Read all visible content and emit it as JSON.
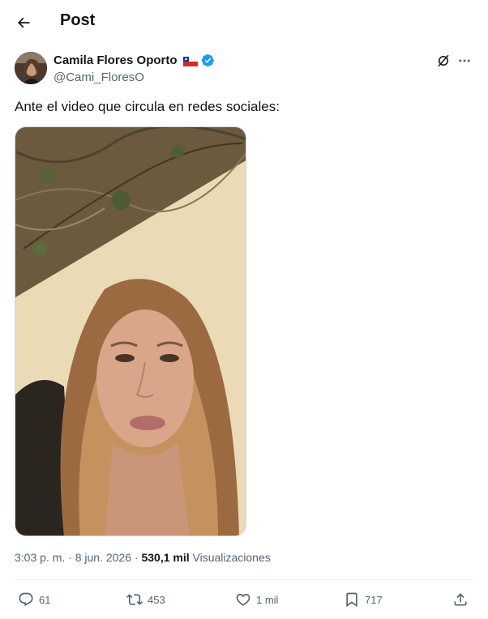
{
  "header": {
    "title": "Post",
    "back_icon": "arrow-left-icon"
  },
  "author": {
    "display_name": "Camila Flores Oporto",
    "flag": "chile-flag-icon",
    "verified": true,
    "handle": "@Cami_FloresO"
  },
  "post": {
    "text": "Ante el video que circula en redes sociales:",
    "media_type": "video"
  },
  "meta": {
    "time": "3:03 p. m.",
    "separator": "·",
    "date": "8 jun. 2026",
    "views_count": "530,1 mil",
    "views_label": "Visualizaciones"
  },
  "actions": {
    "replies": "61",
    "reposts": "453",
    "likes": "1 mil",
    "bookmarks": "717"
  },
  "colors": {
    "verified": "#1d9bf0",
    "secondary_text": "#536471",
    "primary_text": "#0f1419"
  }
}
